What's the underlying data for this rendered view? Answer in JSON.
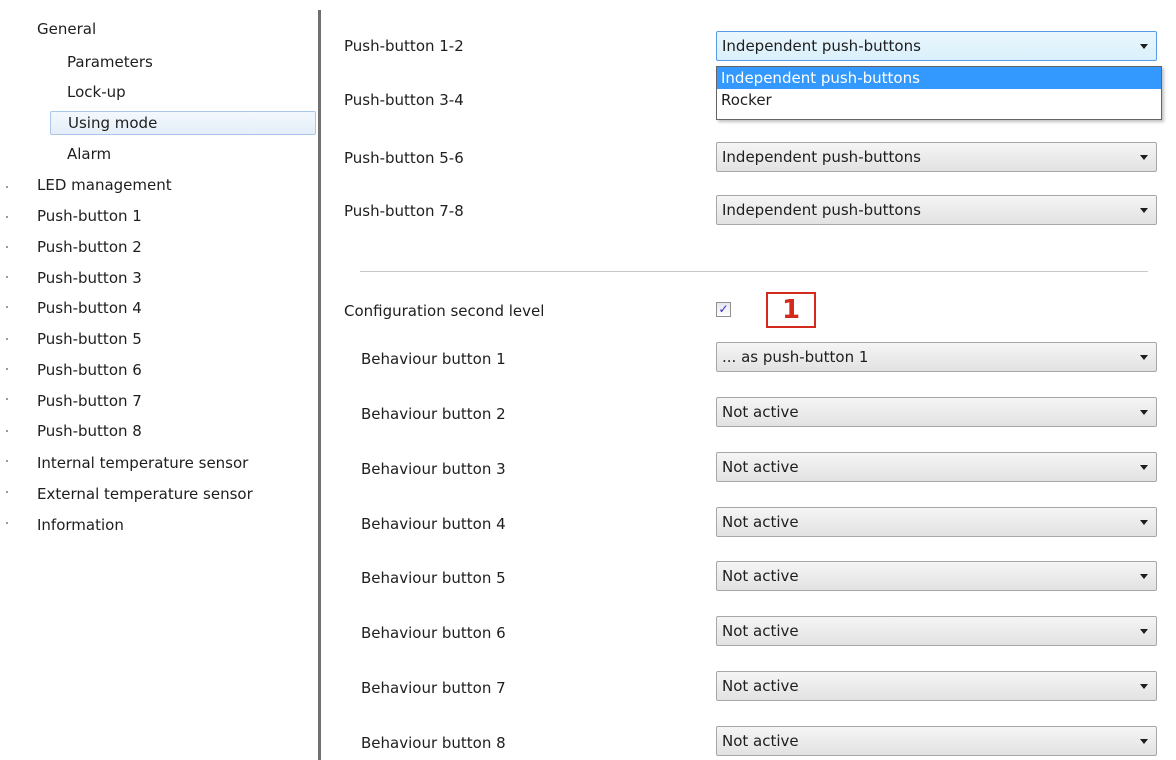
{
  "sidebar": {
    "items": [
      {
        "label": "General"
      },
      {
        "label": "Parameters"
      },
      {
        "label": "Lock-up"
      },
      {
        "label": "Using mode"
      },
      {
        "label": "Alarm"
      },
      {
        "label": "LED management"
      },
      {
        "label": "Push-button 1"
      },
      {
        "label": "Push-button 2"
      },
      {
        "label": "Push-button 3"
      },
      {
        "label": "Push-button 4"
      },
      {
        "label": "Push-button 5"
      },
      {
        "label": "Push-button 6"
      },
      {
        "label": "Push-button 7"
      },
      {
        "label": "Push-button 8"
      },
      {
        "label": "Internal temperature sensor"
      },
      {
        "label": "External temperature sensor"
      },
      {
        "label": "Information"
      }
    ],
    "selected": "Using mode"
  },
  "params": {
    "pb12": {
      "label": "Push-button 1-2",
      "value": "Independent push-buttons"
    },
    "pb34": {
      "label": "Push-button 3-4"
    },
    "pb56": {
      "label": "Push-button 5-6",
      "value": "Independent push-buttons"
    },
    "pb78": {
      "label": "Push-button 7-8",
      "value": "Independent push-buttons"
    }
  },
  "dropdown": {
    "options": [
      "Independent push-buttons",
      "Rocker"
    ],
    "highlighted": "Independent push-buttons"
  },
  "second_level": {
    "label": "Configuration second level",
    "checked": true,
    "check_glyph": "✓"
  },
  "callout": {
    "text": "1",
    "color": "#d42a1e"
  },
  "behaviours": [
    {
      "label": "Behaviour button 1",
      "value": "... as push-button 1"
    },
    {
      "label": "Behaviour button 2",
      "value": "Not active"
    },
    {
      "label": "Behaviour button 3",
      "value": "Not active"
    },
    {
      "label": "Behaviour button 4",
      "value": "Not active"
    },
    {
      "label": "Behaviour button 5",
      "value": "Not active"
    },
    {
      "label": "Behaviour button 6",
      "value": "Not active"
    },
    {
      "label": "Behaviour button 7",
      "value": "Not active"
    },
    {
      "label": "Behaviour button 8",
      "value": "Not active"
    }
  ]
}
